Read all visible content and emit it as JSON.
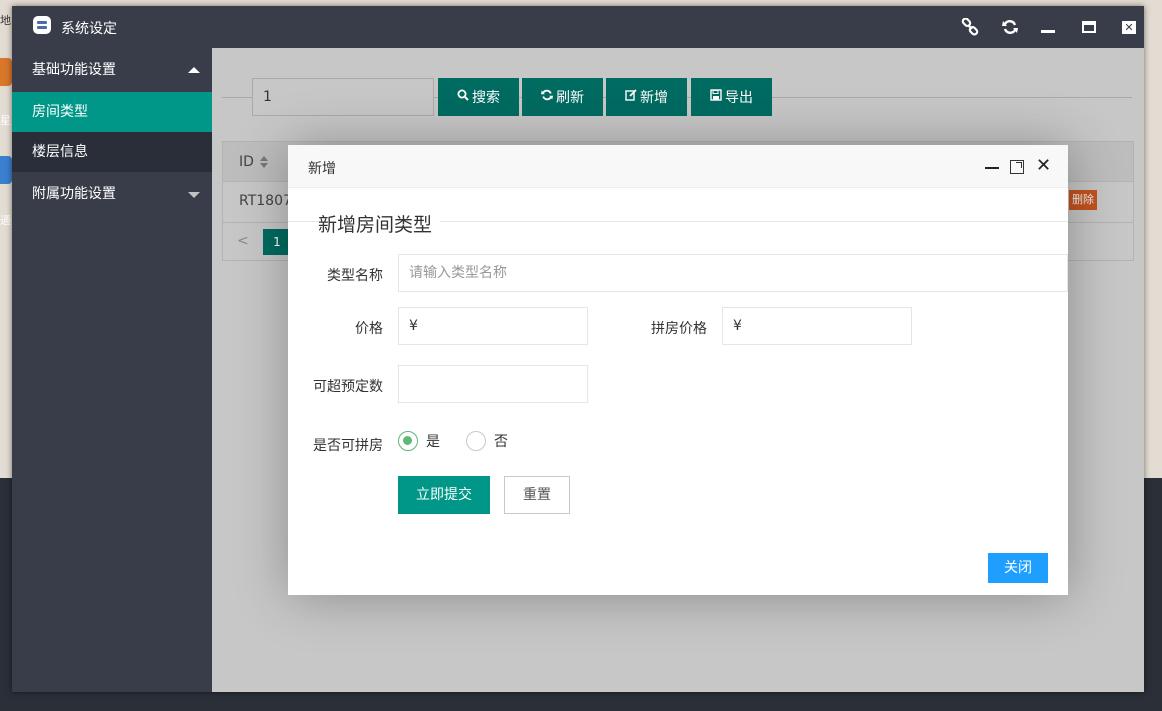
{
  "desktop": {
    "labels": [
      "地",
      "星",
      "通"
    ]
  },
  "window": {
    "title": "系统设定",
    "controls": [
      "link-icon",
      "refresh-icon",
      "minimize-icon",
      "maximize-icon",
      "close-icon"
    ]
  },
  "sidebar": {
    "groups": [
      {
        "label": "基础功能设置",
        "expanded": true,
        "children": [
          {
            "label": "房间类型",
            "active": true
          },
          {
            "label": "楼层信息",
            "active": false
          }
        ]
      },
      {
        "label": "附属功能设置",
        "expanded": false
      }
    ]
  },
  "toolbar": {
    "search_value": "1",
    "buttons": [
      {
        "label": "搜索",
        "icon": "search-icon"
      },
      {
        "label": "刷新",
        "icon": "refresh-icon"
      },
      {
        "label": "新增",
        "icon": "edit-icon"
      },
      {
        "label": "导出",
        "icon": "save-icon"
      }
    ]
  },
  "table": {
    "header_id": "ID",
    "row_id": "RT1807",
    "delete_label": "删除",
    "pager_current": "1"
  },
  "dialog": {
    "title": "新增",
    "form_title": "新增房间类型",
    "fields": {
      "type_name_label": "类型名称",
      "type_name_placeholder": "请输入类型名称",
      "price_label": "价格",
      "price_value": "¥",
      "share_price_label": "拼房价格",
      "share_price_value": "¥",
      "overbook_label": "可超预定数",
      "overbook_value": "",
      "can_share_label": "是否可拼房",
      "yes_label": "是",
      "no_label": "否",
      "can_share_selected": "是"
    },
    "submit_label": "立即提交",
    "reset_label": "重置",
    "close_label": "关闭"
  },
  "colors": {
    "primary": "#009688",
    "primary_dark_overlay": "#006b61",
    "sidebar": "#393d49",
    "radio_on": "#5fb878",
    "close_button": "#1e9fff",
    "delete_button": "#ff5722"
  }
}
